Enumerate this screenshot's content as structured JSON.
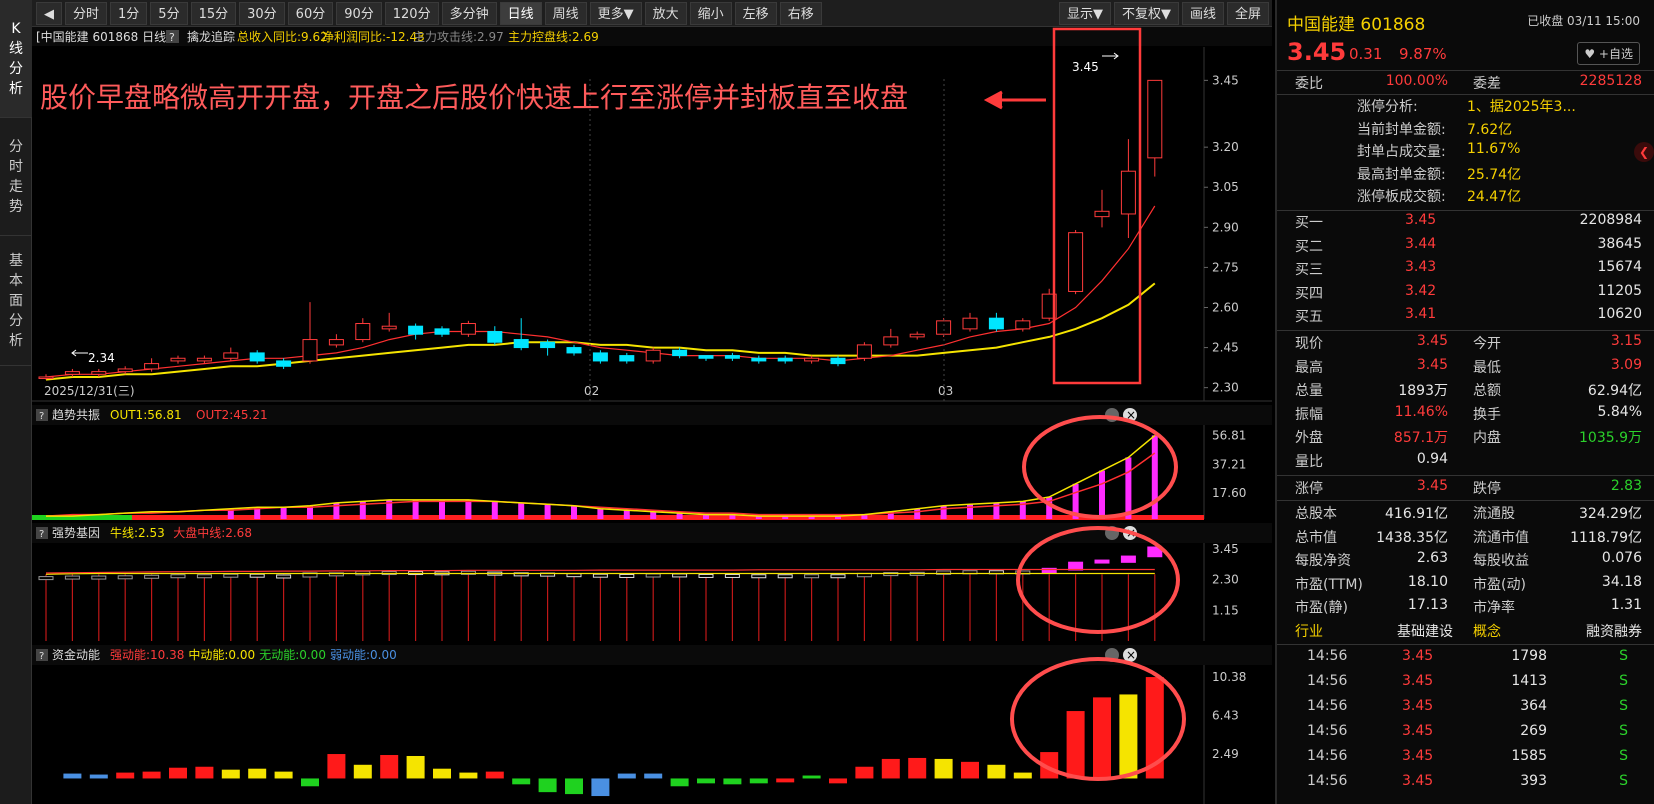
{
  "lefttabs": [
    {
      "label": "K\n线\n分\n析"
    },
    {
      "label": "分\n时\n走\n势"
    },
    {
      "label": "基\n本\n面\n分\n析"
    }
  ],
  "toolbar": {
    "collapse_icon": "◀",
    "periods": [
      "分时",
      "1分",
      "5分",
      "15分",
      "30分",
      "60分",
      "90分",
      "120分",
      "多分钟",
      "日线",
      "周线",
      "更多▼",
      "放大",
      "缩小",
      "左移",
      "右移"
    ],
    "right": [
      "显示▼",
      "不复权▼",
      "画线",
      "全屏"
    ],
    "active": "日线"
  },
  "header": {
    "name": "[中国能建 601868 日线]",
    "help": "?",
    "ind_name": "擒龙追踪",
    "ind_1": "总收入同比:9.62",
    "ind_2": "净利润同比:-12.43",
    "ind_3": "主力攻击线:2.97",
    "ind_4": "主力控盘线:2.69"
  },
  "annotation": "股价早盘略微高开开盘，开盘之后股价快速上行至涨停并封板直至收盘",
  "main_chart": {
    "y_ticks": [
      "3.45",
      "3.20",
      "3.05",
      "2.90",
      "2.75",
      "2.60",
      "2.45",
      "2.30"
    ],
    "high_label": "3.45",
    "low_label": "2.34",
    "date_labels": [
      "2025/12/31(三)",
      "02",
      "03"
    ]
  },
  "chart_data": [
    {
      "type": "candlestick",
      "title": "中国能建 601868 日线",
      "candles": [
        {
          "o": 2.34,
          "c": 2.34,
          "h": 2.35,
          "l": 2.33
        },
        {
          "o": 2.35,
          "c": 2.36,
          "h": 2.37,
          "l": 2.34
        },
        {
          "o": 2.35,
          "c": 2.36,
          "h": 2.37,
          "l": 2.34
        },
        {
          "o": 2.36,
          "c": 2.37,
          "h": 2.38,
          "l": 2.35
        },
        {
          "o": 2.37,
          "c": 2.39,
          "h": 2.41,
          "l": 2.36
        },
        {
          "o": 2.4,
          "c": 2.41,
          "h": 2.42,
          "l": 2.39
        },
        {
          "o": 2.4,
          "c": 2.41,
          "h": 2.42,
          "l": 2.39
        },
        {
          "o": 2.41,
          "c": 2.43,
          "h": 2.45,
          "l": 2.4
        },
        {
          "o": 2.43,
          "c": 2.4,
          "h": 2.44,
          "l": 2.39
        },
        {
          "o": 2.4,
          "c": 2.38,
          "h": 2.41,
          "l": 2.37
        },
        {
          "o": 2.4,
          "c": 2.48,
          "h": 2.62,
          "l": 2.39
        },
        {
          "o": 2.46,
          "c": 2.48,
          "h": 2.5,
          "l": 2.45
        },
        {
          "o": 2.48,
          "c": 2.54,
          "h": 2.56,
          "l": 2.47
        },
        {
          "o": 2.52,
          "c": 2.53,
          "h": 2.58,
          "l": 2.51
        },
        {
          "o": 2.53,
          "c": 2.5,
          "h": 2.54,
          "l": 2.48
        },
        {
          "o": 2.52,
          "c": 2.5,
          "h": 2.53,
          "l": 2.49
        },
        {
          "o": 2.5,
          "c": 2.54,
          "h": 2.55,
          "l": 2.49
        },
        {
          "o": 2.51,
          "c": 2.47,
          "h": 2.53,
          "l": 2.46
        },
        {
          "o": 2.48,
          "c": 2.45,
          "h": 2.56,
          "l": 2.44
        },
        {
          "o": 2.47,
          "c": 2.45,
          "h": 2.48,
          "l": 2.42
        },
        {
          "o": 2.45,
          "c": 2.43,
          "h": 2.46,
          "l": 2.42
        },
        {
          "o": 2.43,
          "c": 2.4,
          "h": 2.44,
          "l": 2.39
        },
        {
          "o": 2.42,
          "c": 2.4,
          "h": 2.43,
          "l": 2.39
        },
        {
          "o": 2.4,
          "c": 2.44,
          "h": 2.45,
          "l": 2.39
        },
        {
          "o": 2.44,
          "c": 2.42,
          "h": 2.45,
          "l": 2.41
        },
        {
          "o": 2.42,
          "c": 2.41,
          "h": 2.42,
          "l": 2.4
        },
        {
          "o": 2.42,
          "c": 2.41,
          "h": 2.43,
          "l": 2.4
        },
        {
          "o": 2.41,
          "c": 2.4,
          "h": 2.42,
          "l": 2.39
        },
        {
          "o": 2.41,
          "c": 2.4,
          "h": 2.42,
          "l": 2.39
        },
        {
          "o": 2.4,
          "c": 2.41,
          "h": 2.42,
          "l": 2.39
        },
        {
          "o": 2.41,
          "c": 2.39,
          "h": 2.42,
          "l": 2.38
        },
        {
          "o": 2.41,
          "c": 2.46,
          "h": 2.47,
          "l": 2.4
        },
        {
          "o": 2.46,
          "c": 2.49,
          "h": 2.52,
          "l": 2.45
        },
        {
          "o": 2.49,
          "c": 2.5,
          "h": 2.51,
          "l": 2.48
        },
        {
          "o": 2.5,
          "c": 2.55,
          "h": 2.56,
          "l": 2.49
        },
        {
          "o": 2.52,
          "c": 2.56,
          "h": 2.58,
          "l": 2.51
        },
        {
          "o": 2.56,
          "c": 2.52,
          "h": 2.58,
          "l": 2.51
        },
        {
          "o": 2.52,
          "c": 2.55,
          "h": 2.56,
          "l": 2.51
        },
        {
          "o": 2.56,
          "c": 2.65,
          "h": 2.67,
          "l": 2.55
        },
        {
          "o": 2.66,
          "c": 2.88,
          "h": 2.89,
          "l": 2.65
        },
        {
          "o": 2.94,
          "c": 2.96,
          "h": 3.04,
          "l": 2.9
        },
        {
          "o": 2.95,
          "c": 3.11,
          "h": 3.23,
          "l": 2.86
        },
        {
          "o": 3.16,
          "c": 3.45,
          "h": 3.45,
          "l": 3.09
        }
      ],
      "ma5": [
        2.34,
        2.35,
        2.35,
        2.36,
        2.37,
        2.38,
        2.39,
        2.4,
        2.41,
        2.41,
        2.42,
        2.43,
        2.45,
        2.48,
        2.5,
        2.51,
        2.51,
        2.51,
        2.5,
        2.49,
        2.47,
        2.45,
        2.44,
        2.43,
        2.42,
        2.42,
        2.42,
        2.41,
        2.41,
        2.41,
        2.4,
        2.41,
        2.42,
        2.44,
        2.46,
        2.49,
        2.51,
        2.52,
        2.54,
        2.6,
        2.7,
        2.82,
        2.98
      ],
      "ma10": [
        2.33,
        2.34,
        2.34,
        2.35,
        2.35,
        2.36,
        2.37,
        2.38,
        2.38,
        2.39,
        2.4,
        2.41,
        2.42,
        2.43,
        2.44,
        2.45,
        2.46,
        2.46,
        2.47,
        2.47,
        2.47,
        2.46,
        2.46,
        2.45,
        2.45,
        2.44,
        2.44,
        2.43,
        2.43,
        2.42,
        2.42,
        2.42,
        2.42,
        2.42,
        2.43,
        2.44,
        2.45,
        2.47,
        2.49,
        2.52,
        2.56,
        2.61,
        2.69
      ],
      "ylim": [
        2.28,
        3.5
      ],
      "ma_colors": [
        "#ff3030",
        "#f5e400"
      ]
    },
    {
      "type": "bar",
      "title": "趋势共振",
      "series": [
        {
          "name": "OUT1",
          "values": [
            2,
            2,
            3,
            4,
            5,
            5,
            6,
            7,
            8,
            8,
            9,
            11,
            12,
            13,
            13,
            13,
            13,
            12,
            11,
            10,
            9,
            7,
            6,
            5,
            4,
            3,
            3,
            2,
            2,
            2,
            2,
            3,
            5,
            7,
            9,
            10,
            11,
            12,
            15,
            24,
            33,
            42,
            57
          ]
        },
        {
          "name": "OUT2",
          "values": [
            2,
            3,
            3,
            4,
            4,
            5,
            6,
            6,
            7,
            8,
            8,
            9,
            10,
            11,
            12,
            12,
            12,
            12,
            11,
            10,
            9,
            8,
            7,
            6,
            5,
            4,
            4,
            3,
            3,
            3,
            3,
            3,
            4,
            5,
            7,
            8,
            9,
            10,
            12,
            18,
            24,
            32,
            45
          ]
        }
      ],
      "ylim": [
        0,
        60
      ],
      "y_ticks": [
        "56.81",
        "37.21",
        "17.60"
      ],
      "value_labels": {
        "out1": "OUT1:56.81",
        "out2": "OUT2:45.21"
      }
    },
    {
      "type": "bar",
      "title": "强势基因",
      "series": [
        {
          "name": "牛线",
          "values": [
            2.5,
            2.52,
            2.53,
            2.53,
            2.53,
            2.53,
            2.53,
            2.53,
            2.53,
            2.53,
            2.53,
            2.53,
            2.53,
            2.53,
            2.53,
            2.53,
            2.53,
            2.53,
            2.53,
            2.53,
            2.53,
            2.53,
            2.53,
            2.53,
            2.53,
            2.53,
            2.53,
            2.53,
            2.53,
            2.53,
            2.53,
            2.53,
            2.53,
            2.53,
            2.53,
            2.53,
            2.53,
            2.53,
            2.53,
            2.53,
            2.53,
            2.53,
            2.53
          ]
        },
        {
          "name": "大盘中线",
          "values": [
            2.55,
            2.56,
            2.57,
            2.58,
            2.59,
            2.6,
            2.6,
            2.61,
            2.61,
            2.62,
            2.62,
            2.63,
            2.63,
            2.64,
            2.64,
            2.64,
            2.65,
            2.65,
            2.65,
            2.65,
            2.65,
            2.66,
            2.66,
            2.66,
            2.66,
            2.66,
            2.66,
            2.67,
            2.67,
            2.67,
            2.67,
            2.67,
            2.67,
            2.67,
            2.68,
            2.68,
            2.68,
            2.68,
            2.68,
            2.68,
            2.68,
            2.68,
            2.68
          ]
        }
      ],
      "ylim": [
        0,
        3.6
      ],
      "y_ticks": [
        "3.45",
        "2.30",
        "1.15"
      ],
      "value_labels": {
        "bull": "牛线:2.53",
        "mid": "大盘中线:2.68"
      }
    },
    {
      "type": "bar",
      "title": "资金动能",
      "values": [
        0.5,
        0.4,
        0.6,
        0.7,
        1.1,
        1.2,
        0.9,
        1.0,
        0.7,
        -0.8,
        2.5,
        1.4,
        2.4,
        2.3,
        1.0,
        0.6,
        0.7,
        -0.6,
        -1.4,
        -1.6,
        -1.8,
        0.5,
        0.5,
        -0.8,
        -0.5,
        -0.6,
        -0.5,
        -0.4,
        0.3,
        -0.5,
        1.2,
        2.0,
        2.1,
        2.0,
        1.7,
        1.4,
        0.6,
        2.7,
        6.9,
        8.3,
        8.6,
        10.38
      ],
      "colors": [
        "blue",
        "blue",
        "red",
        "red",
        "red",
        "red",
        "yellow",
        "yellow",
        "yellow",
        "green",
        "red",
        "yellow",
        "red",
        "yellow",
        "yellow",
        "yellow",
        "red",
        "green",
        "green",
        "green",
        "blue",
        "blue",
        "blue",
        "green",
        "green",
        "green",
        "green",
        "red",
        "green",
        "red",
        "red",
        "red",
        "red",
        "yellow",
        "red",
        "yellow",
        "yellow",
        "red",
        "red",
        "red",
        "yellow",
        "red"
      ],
      "ylim": [
        -2,
        11
      ],
      "y_ticks": [
        "10.38",
        "6.43",
        "2.49"
      ],
      "value_labels": {
        "strong": "强动能:10.38",
        "mid": "中动能:0.00",
        "none": "无动能:0.00",
        "weak": "弱动能:0.00"
      }
    }
  ],
  "right": {
    "name": "中国能建 601868",
    "status": "已收盘 03/11 15:00",
    "price": "3.45",
    "change": "0.31",
    "pct": "9.87%",
    "fav": "+自选",
    "webi_label": "委比",
    "webi": "100.00%",
    "wecha_label": "委差",
    "wecha": "2285128",
    "limit_rows": [
      {
        "k": "涨停分析:",
        "v": "1、据2025年3..."
      },
      {
        "k": "当前封单金额:",
        "v": "7.62亿"
      },
      {
        "k": "封单占成交量:",
        "v": "11.67%"
      },
      {
        "k": "最高封单金额:",
        "v": "25.74亿"
      },
      {
        "k": "涨停板成交额:",
        "v": "24.47亿"
      }
    ],
    "bids": [
      {
        "k": "买一",
        "p": "3.45",
        "v": "2208984"
      },
      {
        "k": "买二",
        "p": "3.44",
        "v": "38645"
      },
      {
        "k": "买三",
        "p": "3.43",
        "v": "15674"
      },
      {
        "k": "买四",
        "p": "3.42",
        "v": "11205"
      },
      {
        "k": "买五",
        "p": "3.41",
        "v": "10620"
      }
    ],
    "stats": [
      {
        "k1": "现价",
        "v1": "3.45",
        "c1": "red",
        "k2": "今开",
        "v2": "3.15",
        "c2": "red"
      },
      {
        "k1": "最高",
        "v1": "3.45",
        "c1": "red",
        "k2": "最低",
        "v2": "3.09",
        "c2": "red"
      },
      {
        "k1": "总量",
        "v1": "1893万",
        "c1": "white",
        "k2": "总额",
        "v2": "62.94亿",
        "c2": "white"
      },
      {
        "k1": "振幅",
        "v1": "11.46%",
        "c1": "red",
        "k2": "换手",
        "v2": "5.84%",
        "c2": "white"
      },
      {
        "k1": "外盘",
        "v1": "857.1万",
        "c1": "red",
        "k2": "内盘",
        "v2": "1035.9万",
        "c2": "green"
      },
      {
        "k1": "量比",
        "v1": "0.94",
        "c1": "white",
        "k2": "",
        "v2": "",
        "c2": "white"
      }
    ],
    "limits": {
      "k1": "涨停",
      "v1": "3.45",
      "k2": "跌停",
      "v2": "2.83"
    },
    "fund": [
      {
        "k1": "总股本",
        "v1": "416.91亿",
        "k2": "流通股",
        "v2": "324.29亿"
      },
      {
        "k1": "总市值",
        "v1": "1438.35亿",
        "k2": "流通市值",
        "v2": "1118.79亿"
      },
      {
        "k1": "每股净资",
        "v1": "2.63",
        "k2": "每股收益",
        "v2": "0.076"
      },
      {
        "k1": "市盈(TTM)",
        "v1": "18.10",
        "k2": "市盈(动)",
        "v2": "34.18"
      },
      {
        "k1": "市盈(静)",
        "v1": "17.13",
        "k2": "市净率",
        "v2": "1.31"
      }
    ],
    "industry": {
      "k1": "行业",
      "v1": "基础建设",
      "k2": "概念",
      "v2": "融资融券"
    },
    "ticks": [
      {
        "t": "14:56",
        "p": "3.45",
        "v": "1798",
        "s": "S"
      },
      {
        "t": "14:56",
        "p": "3.45",
        "v": "1413",
        "s": "S"
      },
      {
        "t": "14:56",
        "p": "3.45",
        "v": "364",
        "s": "S"
      },
      {
        "t": "14:56",
        "p": "3.45",
        "v": "269",
        "s": "S"
      },
      {
        "t": "14:56",
        "p": "3.45",
        "v": "1585",
        "s": "S"
      },
      {
        "t": "14:56",
        "p": "3.45",
        "v": "393",
        "s": "S"
      }
    ]
  }
}
